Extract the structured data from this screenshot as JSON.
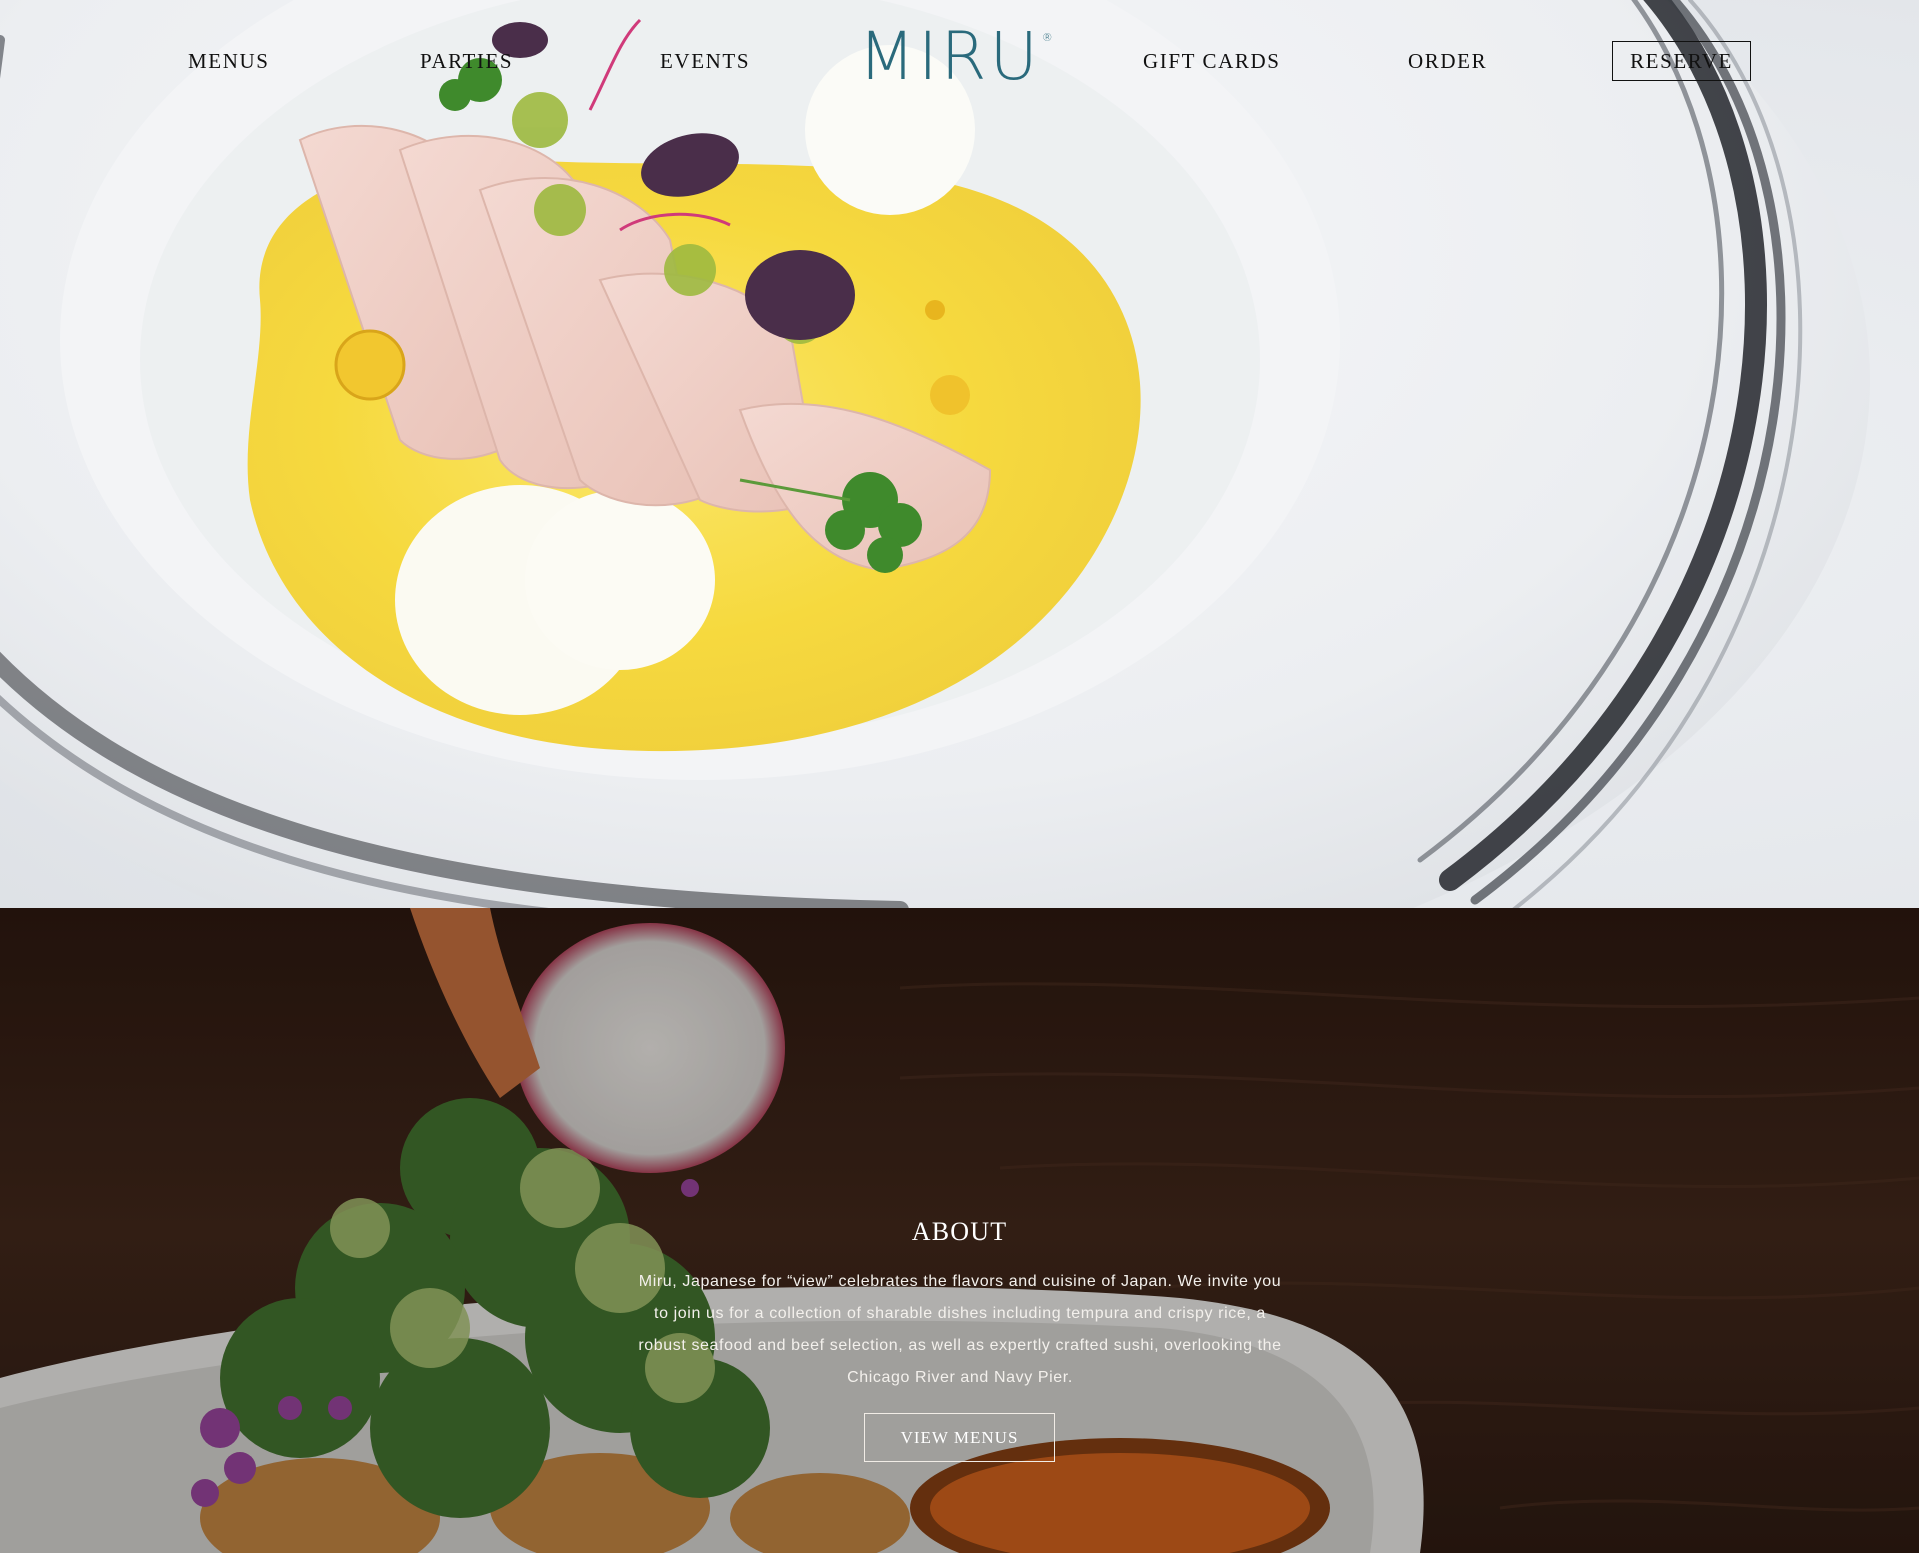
{
  "nav": {
    "menus": "MENUS",
    "parties": "PARTIES",
    "events": "EVENTS",
    "gift_cards": "GIFT CARDS",
    "order": "ORDER",
    "reserve": "RESERVE"
  },
  "logo": {
    "text": "MIRU",
    "mark": "®",
    "color": "#2a6a7c"
  },
  "about": {
    "title": "ABOUT",
    "body": "Miru, Japanese for “view” celebrates the flavors and cuisine of Japan. We invite you to join us for a collection of sharable dishes including tempura and crispy rice, a robust seafood and beef selection, as well as expertly crafted sushi, overlooking the Chicago River and Navy Pier.",
    "button": "VIEW MENUS"
  }
}
